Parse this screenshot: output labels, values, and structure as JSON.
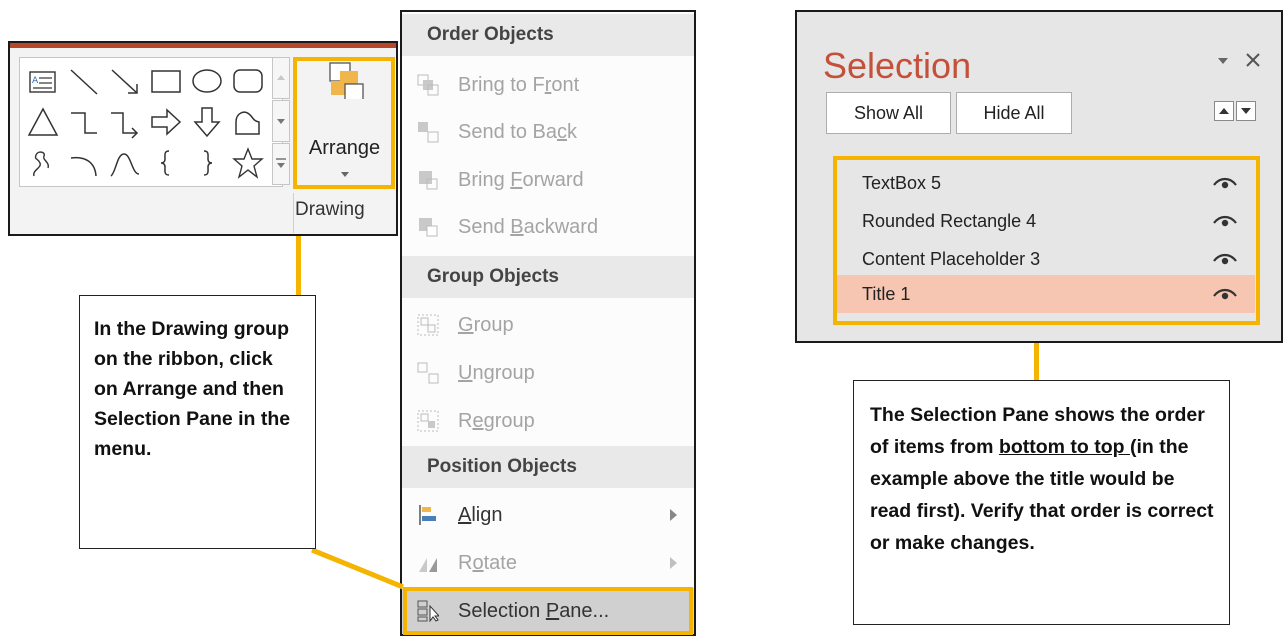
{
  "ribbon": {
    "arrange_label": "Arrange",
    "group_label": "Drawing",
    "shape_icons": [
      "text-box-icon",
      "line-icon",
      "arrow-line-icon",
      "rectangle-icon",
      "oval-icon",
      "rounded-rectangle-icon",
      "triangle-icon",
      "elbow-connector-icon",
      "elbow-arrow-connector-icon",
      "right-arrow-icon",
      "down-arrow-icon",
      "freeform-icon",
      "curve-scribble-icon",
      "arc-icon",
      "curve-icon",
      "left-brace-icon",
      "right-brace-icon",
      "star-icon"
    ]
  },
  "menu": {
    "order_header": "Order Objects",
    "bring_to_front": {
      "before": "Bring to F",
      "key": "r",
      "after": "ont"
    },
    "send_to_back": {
      "before": "Send to Ba",
      "key": "c",
      "after": "k"
    },
    "bring_forward": {
      "before": "Bring ",
      "key": "F",
      "after": "orward"
    },
    "send_backward": {
      "before": "Send ",
      "key": "B",
      "after": "ackward"
    },
    "group_header": "Group Objects",
    "group": {
      "before": "",
      "key": "G",
      "after": "roup"
    },
    "ungroup": {
      "before": "",
      "key": "U",
      "after": "ngroup"
    },
    "regroup": {
      "before": "R",
      "key": "e",
      "after": "group"
    },
    "position_header": "Position Objects",
    "align": {
      "before": "",
      "key": "A",
      "after": "lign"
    },
    "rotate": {
      "before": "R",
      "key": "o",
      "after": "tate"
    },
    "selection_pane": {
      "before": "Selection ",
      "key": "P",
      "after": "ane..."
    }
  },
  "pane": {
    "title": "Selection",
    "show_all": "Show All",
    "hide_all": "Hide All",
    "items": [
      "TextBox 5",
      "Rounded Rectangle 4",
      "Content Placeholder 3",
      "Title 1"
    ],
    "selected_index": 3
  },
  "callouts": {
    "left": "In the Drawing group on the ribbon, click on Arrange and then Selection Pane in the menu.",
    "right_before": "The Selection Pane shows the order of items from ",
    "right_underlined": "bottom to top ",
    "right_after": "(in the example above the title would be read first). Verify that order is correct or make changes."
  },
  "colors": {
    "highlight": "#f5b400",
    "pane_title": "#c4503a",
    "selected_row": "#f6c6b2",
    "ribbon_accent": "#b7472a"
  }
}
